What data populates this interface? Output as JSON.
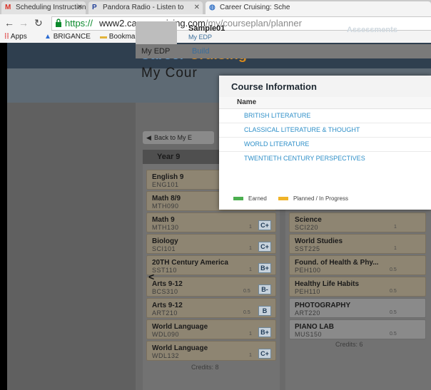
{
  "browser": {
    "tabs": [
      {
        "label": "Scheduling Instructions - ",
        "icon": "gmail-icon"
      },
      {
        "label": "Pandora Radio - Listen to",
        "icon": "pandora-icon"
      },
      {
        "label": "Career Cruising: Sche",
        "icon": "globe-icon"
      }
    ],
    "url_scheme": "https://",
    "url_host": "www2.careercruising.com",
    "url_path": "/my/courseplan/planner",
    "bookmarks": [
      {
        "label": "Apps",
        "icon": "apps-grid-icon"
      },
      {
        "label": "BRIGANCE",
        "icon": "brigance-icon"
      },
      {
        "label": "Bookmarks",
        "icon": "folder-icon"
      }
    ]
  },
  "site": {
    "logo_part1": "Career",
    "logo_part2": "Cruising",
    "brand_colors": {
      "blue": "#5a8fc0",
      "orange": "#d98a1c"
    }
  },
  "profile": {
    "name": "Sample01",
    "sub": "My EDP",
    "assessments_label": "Assessments"
  },
  "subnav": {
    "my_edp": "My EDP",
    "build": "Build"
  },
  "page": {
    "title": "My Cour",
    "back_button": "Back to My E"
  },
  "planner": {
    "year_label": "Year 9",
    "left_courses": [
      {
        "name": "English 9",
        "code": "ENG101",
        "credits": "",
        "grade": ""
      },
      {
        "name": "Math 8/9",
        "code": "MTH090",
        "credits": "",
        "grade": ""
      },
      {
        "name": "Math 9",
        "code": "MTH130",
        "credits": "1",
        "grade": "C+"
      },
      {
        "name": "Biology",
        "code": "SCI101",
        "credits": "1",
        "grade": "C+"
      },
      {
        "name": "20TH Century America",
        "code": "SST110",
        "credits": "1",
        "grade": "B+"
      },
      {
        "name": "Arts 9-12",
        "code": "BCS310",
        "credits": "0.5",
        "grade": "B-"
      },
      {
        "name": "Arts 9-12",
        "code": "ART210",
        "credits": "0.5",
        "grade": "B"
      },
      {
        "name": "World Language",
        "code": "WDL090",
        "credits": "1",
        "grade": "B+"
      },
      {
        "name": "World Language",
        "code": "WDL132",
        "credits": "1",
        "grade": "C+"
      }
    ],
    "left_credits": "Credits: 8",
    "right_courses": [
      {
        "name": "Science",
        "code": "SCI220",
        "credits": "1",
        "grade": ""
      },
      {
        "name": "World Studies",
        "code": "SST225",
        "credits": "1",
        "grade": ""
      },
      {
        "name": "Found. of Health & Phy...",
        "code": "PEH100",
        "credits": "0.5",
        "grade": ""
      },
      {
        "name": "Healthy Life Habits",
        "code": "PEH110",
        "credits": "0.5",
        "grade": ""
      },
      {
        "name": "PHOTOGRAPHY",
        "code": "ART220",
        "credits": "0.5",
        "grade": ""
      },
      {
        "name": "PIANO LAB",
        "code": "MUS150",
        "credits": "0.5",
        "grade": ""
      }
    ],
    "right_credits": "Credits: 6"
  },
  "modal": {
    "title": "Course Information",
    "column_header": "Name",
    "rows": [
      "BRITISH LITERATURE",
      "CLASSICAL LITERATURE & THOUGHT",
      "WORLD LITERATURE",
      "TWENTIETH CENTURY PERSPECTIVES"
    ],
    "legend": [
      {
        "label": "Earned",
        "color": "#4caf50"
      },
      {
        "label": "Planned / In Progress",
        "color": "#f0b429"
      }
    ]
  }
}
